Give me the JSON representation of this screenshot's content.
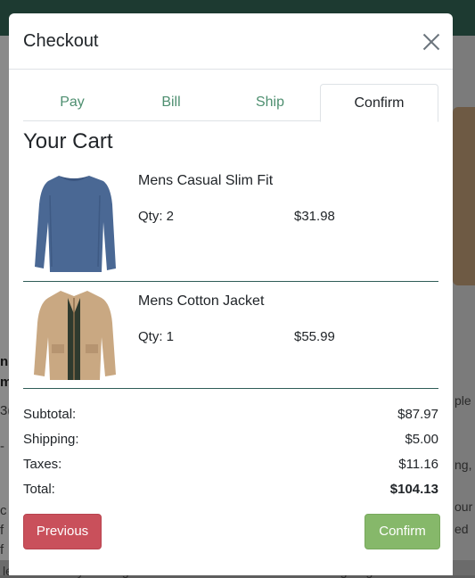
{
  "modal": {
    "title": "Checkout",
    "close_icon": "close-icon"
  },
  "tabs": [
    {
      "label": "Pay",
      "active": false
    },
    {
      "label": "Bill",
      "active": false
    },
    {
      "label": "Ship",
      "active": false
    },
    {
      "label": "Confirm",
      "active": true
    }
  ],
  "cart": {
    "title": "Your Cart",
    "items": [
      {
        "name": "Mens Casual Slim Fit",
        "qty_label": "Qty: 2",
        "price": "$31.98",
        "image_icon": "blue-long-sleeve-shirt-image"
      },
      {
        "name": "Mens Cotton Jacket",
        "qty_label": "Qty: 1",
        "price": "$55.99",
        "image_icon": "tan-cotton-jacket-image"
      }
    ]
  },
  "summary": {
    "subtotal_label": "Subtotal:",
    "subtotal": "$87.97",
    "shipping_label": "Shipping:",
    "shipping": "$5.00",
    "taxes_label": "Taxes:",
    "taxes": "$11.16",
    "total_label": "Total:",
    "total": "$104.13"
  },
  "buttons": {
    "previous": "Previous",
    "confirm": "Confirm"
  },
  "background": {
    "left_fragments": [
      "n",
      "m",
      "3(",
      "-",
      "c",
      "f",
      "f"
    ],
    "bottom_left": "le for durability and a great",
    "right_fragments": [
      "ple",
      "ng,",
      "our",
      "ed",
      "in this thanksgiving or Christmas"
    ]
  },
  "colors": {
    "tab_text": "#4e8f70",
    "divider": "#2f5d57",
    "previous_button": "#c9505b",
    "confirm_button": "#86b86a"
  }
}
